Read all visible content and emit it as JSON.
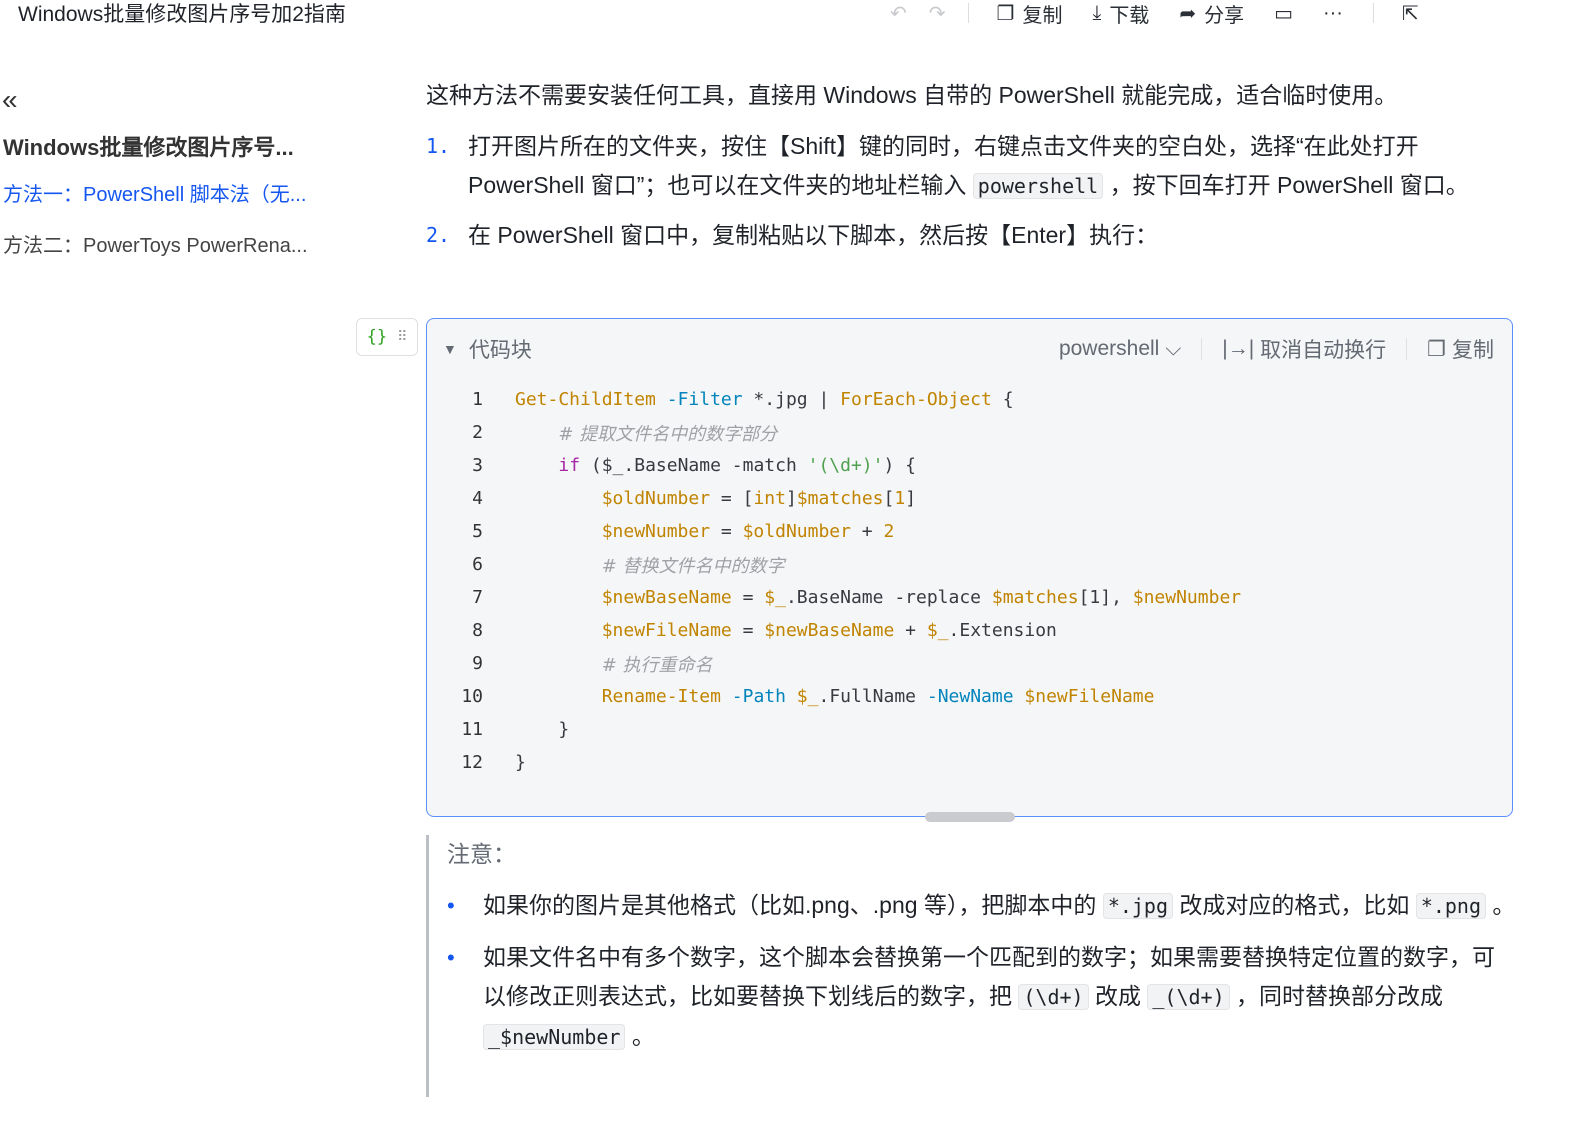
{
  "header": {
    "title": "Windows批量修改图片序号加2指南",
    "undo": "undo-icon",
    "redo": "redo-icon",
    "copy_label": "复制",
    "download_label": "下载",
    "share_label": "分享",
    "more": "···"
  },
  "sidebar": {
    "collapse": "«",
    "toc_title": "Windows批量修改图片序号...",
    "items": [
      {
        "label": "方法一：PowerShell 脚本法（无...",
        "active": true
      },
      {
        "label": "方法二：PowerToys PowerRena...",
        "active": false
      }
    ]
  },
  "main": {
    "intro": "这种方法不需要安装任何工具，直接用 Windows 自带的 PowerShell 就能完成，适合临时使用。",
    "steps": [
      {
        "num": "1.",
        "segments": [
          {
            "t": "打开图片所在的文件夹，按住【Shift】键的同时，右键点击文件夹的空白处，选择“在此处打开 PowerShell 窗口”；也可以在文件夹的地址栏输入 "
          },
          {
            "code": "powershell"
          },
          {
            "t": " ，按下回车打开 PowerShell 窗口。"
          }
        ]
      },
      {
        "num": "2.",
        "segments": [
          {
            "t": "在 PowerShell 窗口中，复制粘贴以下脚本，然后按【Enter】执行："
          }
        ]
      }
    ]
  },
  "codeblock": {
    "title": "代码块",
    "language": "powershell",
    "nowrap_label": "取消自动换行",
    "copy_label": "复制",
    "lines": [
      [
        [
          "k",
          "Get-ChildItem"
        ],
        [
          "n",
          " "
        ],
        [
          "p",
          "-Filter"
        ],
        [
          "n",
          " *.jpg | "
        ],
        [
          "k",
          "ForEach-Object"
        ],
        [
          "n",
          " {"
        ]
      ],
      [
        [
          "n",
          "    "
        ],
        [
          "c",
          "# 提取文件名中的数字部分"
        ]
      ],
      [
        [
          "n",
          "    "
        ],
        [
          "kw",
          "if"
        ],
        [
          "n",
          " ($_.BaseName -match "
        ],
        [
          "s",
          "'(\\d+)'"
        ],
        [
          "n",
          ") {"
        ]
      ],
      [
        [
          "n",
          "        "
        ],
        [
          "k",
          "$oldNumber"
        ],
        [
          "n",
          " = ["
        ],
        [
          "k",
          "int"
        ],
        [
          "n",
          "]"
        ],
        [
          "k",
          "$matches"
        ],
        [
          "n",
          "["
        ],
        [
          "k",
          "1"
        ],
        [
          "n",
          "]"
        ]
      ],
      [
        [
          "n",
          "        "
        ],
        [
          "k",
          "$newNumber"
        ],
        [
          "n",
          " = "
        ],
        [
          "k",
          "$oldNumber"
        ],
        [
          "n",
          " + "
        ],
        [
          "k",
          "2"
        ]
      ],
      [
        [
          "n",
          "        "
        ],
        [
          "c",
          "# 替换文件名中的数字"
        ]
      ],
      [
        [
          "n",
          "        "
        ],
        [
          "k",
          "$newBaseName"
        ],
        [
          "n",
          " = "
        ],
        [
          "k",
          "$_"
        ],
        [
          "n",
          ".BaseName -replace "
        ],
        [
          "k",
          "$matches"
        ],
        [
          "n",
          "[1], "
        ],
        [
          "k",
          "$newNumber"
        ]
      ],
      [
        [
          "n",
          "        "
        ],
        [
          "k",
          "$newFileName"
        ],
        [
          "n",
          " = "
        ],
        [
          "k",
          "$newBaseName"
        ],
        [
          "n",
          " + "
        ],
        [
          "k",
          "$_"
        ],
        [
          "n",
          ".Extension"
        ]
      ],
      [
        [
          "n",
          "        "
        ],
        [
          "c",
          "# 执行重命名"
        ]
      ],
      [
        [
          "n",
          "        "
        ],
        [
          "k",
          "Rename-Item"
        ],
        [
          "n",
          " "
        ],
        [
          "p",
          "-Path"
        ],
        [
          "n",
          " "
        ],
        [
          "k",
          "$_"
        ],
        [
          "n",
          ".FullName "
        ],
        [
          "p",
          "-NewName"
        ],
        [
          "n",
          " "
        ],
        [
          "k",
          "$newFileName"
        ]
      ],
      [
        [
          "n",
          "    }"
        ]
      ],
      [
        [
          "n",
          "}"
        ]
      ]
    ]
  },
  "note": {
    "title": "注意：",
    "bullets": [
      [
        {
          "t": "如果你的图片是其他格式（比如.png、.png 等），把脚本中的 "
        },
        {
          "code": "*.jpg"
        },
        {
          "t": " 改成对应的格式，比如 "
        },
        {
          "code": "*.png"
        },
        {
          "t": " 。"
        }
      ],
      [
        {
          "t": "如果文件名中有多个数字，这个脚本会替换第一个匹配到的数字；如果需要替换特定位置的数字，可以修改正则表达式，比如要替换下划线后的数字，把 "
        },
        {
          "code": "(\\d+)"
        },
        {
          "t": " 改成 "
        },
        {
          "code": "_(\\d+)"
        },
        {
          "t": " ，同时替换部分改成 "
        },
        {
          "code": "_$newNumber"
        },
        {
          "t": " 。"
        }
      ]
    ]
  }
}
